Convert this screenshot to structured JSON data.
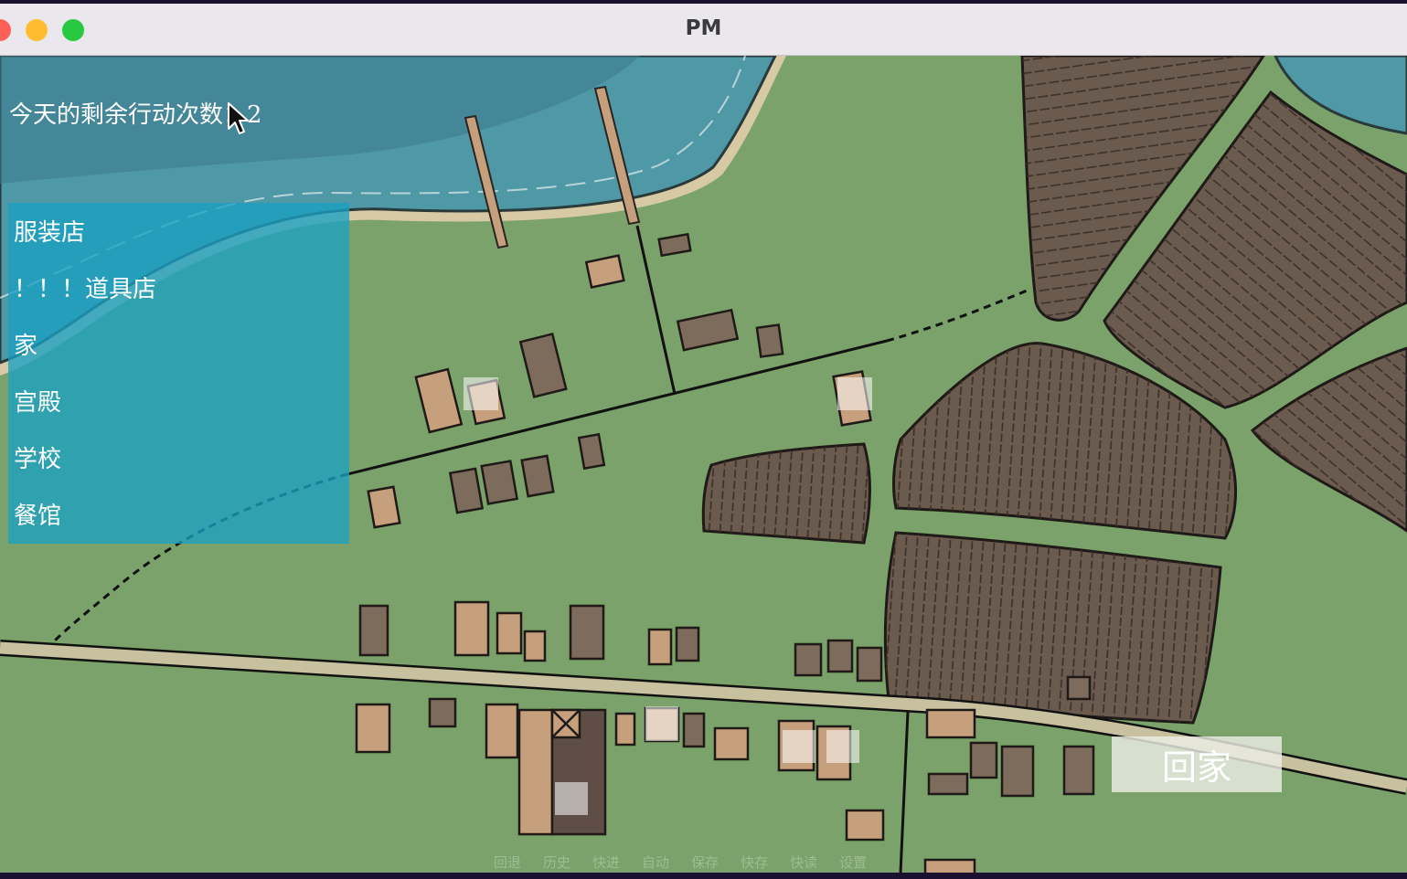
{
  "window": {
    "title": "PM"
  },
  "hud": {
    "actions_label": "今天的剩余行动次数：",
    "actions_remaining": "2"
  },
  "location_menu": {
    "items": [
      "服装店",
      "！！！道具店",
      "家",
      "宫殿",
      "学校",
      "餐馆"
    ]
  },
  "home_button": {
    "label": "回家"
  },
  "quick_menu": {
    "items": [
      "回退",
      "历史",
      "快进",
      "自动",
      "保存",
      "快存",
      "快读",
      "设置"
    ]
  },
  "colors": {
    "grass": "#7aa26a",
    "water": "#4f98a6",
    "field": "#6b5a4e",
    "road": "#c8c1a0",
    "menu_panel": "#19a0c3"
  },
  "icons": {
    "cursor": "mouse-pointer-icon"
  }
}
